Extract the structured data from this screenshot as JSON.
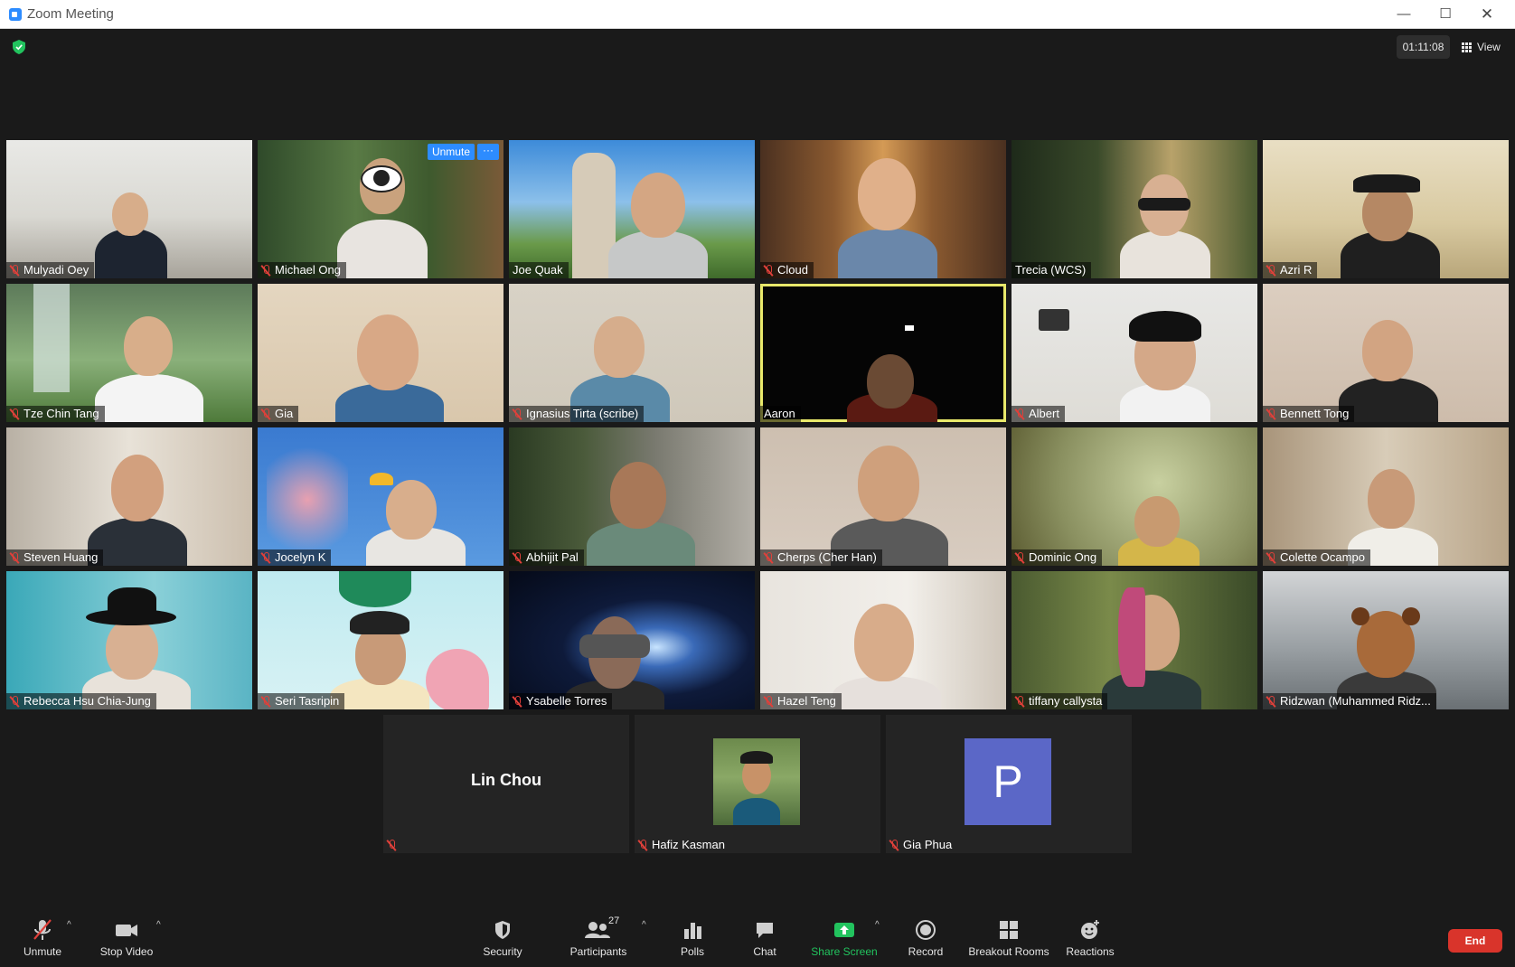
{
  "window": {
    "title": "Zoom Meeting"
  },
  "header": {
    "timer": "01:11:08",
    "view_label": "View"
  },
  "unmute_chip": "Unmute",
  "more_chip": "···",
  "participants": [
    {
      "name": "Mulyadi Oey",
      "muted": true
    },
    {
      "name": "Michael Ong",
      "muted": true
    },
    {
      "name": "Joe Quak",
      "muted": false
    },
    {
      "name": "Cloud",
      "muted": true
    },
    {
      "name": "Trecia (WCS)",
      "muted": false
    },
    {
      "name": "Azri R",
      "muted": true
    },
    {
      "name": "Tze Chin Tang",
      "muted": true
    },
    {
      "name": "Gia",
      "muted": true
    },
    {
      "name": "Ignasius Tirta (scribe)",
      "muted": true
    },
    {
      "name": "Aaron",
      "muted": false,
      "active_speaker": true
    },
    {
      "name": "Albert",
      "muted": true
    },
    {
      "name": "Bennett Tong",
      "muted": true
    },
    {
      "name": "Steven Huang",
      "muted": true
    },
    {
      "name": "Jocelyn K",
      "muted": true
    },
    {
      "name": "Abhijit Pal",
      "muted": true
    },
    {
      "name": "Cherps (Cher Han)",
      "muted": true
    },
    {
      "name": "Dominic Ong",
      "muted": true
    },
    {
      "name": "Colette Ocampo",
      "muted": true
    },
    {
      "name": "Rebecca Hsu Chia-Jung",
      "muted": true
    },
    {
      "name": "Seri Tasripin",
      "muted": true
    },
    {
      "name": "Ysabelle Torres",
      "muted": true
    },
    {
      "name": "Hazel Teng",
      "muted": true
    },
    {
      "name": "tiffany callysta",
      "muted": true
    },
    {
      "name": "Ridzwan (Muhammed Ridz...",
      "muted": true
    }
  ],
  "bottom_row": {
    "lin_chou": {
      "display_name": "Lin Chou"
    },
    "hafiz": {
      "name": "Hafiz Kasman"
    },
    "gia_phua": {
      "name": "Gia Phua",
      "avatar_letter": "P",
      "avatar_color": "#5b67c7"
    }
  },
  "toolbar": {
    "unmute": "Unmute",
    "stop_video": "Stop Video",
    "security": "Security",
    "participants": "Participants",
    "participants_count": "27",
    "polls": "Polls",
    "chat": "Chat",
    "share_screen": "Share Screen",
    "record": "Record",
    "breakout_rooms": "Breakout Rooms",
    "reactions": "Reactions",
    "end": "End"
  },
  "colors": {
    "accent_blue": "#2d8cff",
    "share_green": "#22c35e",
    "end_red": "#d9342b",
    "muted_red": "#e0403a",
    "active_speaker": "#e9e96b"
  }
}
